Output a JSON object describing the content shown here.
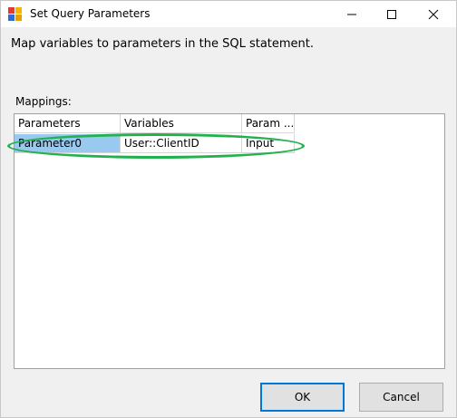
{
  "window": {
    "title": "Set Query Parameters",
    "icon": "ssis-task-icon"
  },
  "description": "Map variables to parameters in the SQL statement.",
  "mappings": {
    "label": "Mappings:",
    "columns": [
      "Parameters",
      "Variables",
      "Param ..."
    ],
    "rows": [
      {
        "parameter": "Parameter0",
        "variable": "User::ClientID",
        "direction": "Input"
      }
    ]
  },
  "buttons": {
    "ok": "OK",
    "cancel": "Cancel"
  },
  "colors": {
    "selection": "#99c9ef",
    "annotation": "#22b14c",
    "default_button_border": "#0078d7"
  }
}
